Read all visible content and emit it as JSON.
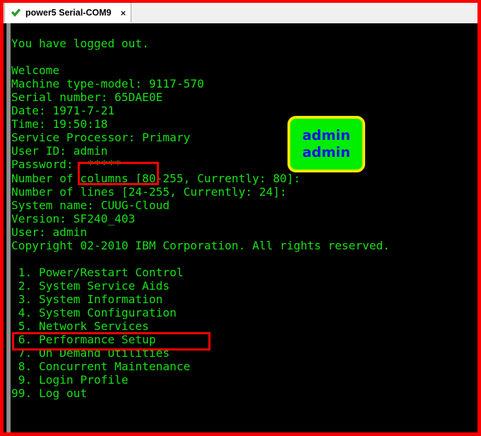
{
  "window": {
    "annotation_border_color": "#fe0000",
    "background_color": "#f0f0f0"
  },
  "tab": {
    "status_icon": "green-check-icon",
    "title": "power5 Serial-COM9",
    "close_label": "×"
  },
  "terminal": {
    "background_color": "#000000",
    "text_color": "#16e016",
    "lines": [
      "",
      "You have logged out.",
      "",
      "Welcome",
      "Machine type-model: 9117-570",
      "Serial number: 65DAE0E",
      "Date: 1971-7-21",
      "Time: 19:50:18",
      "Service Processor: Primary",
      "User ID: admin",
      "Password:  *****",
      "Number of columns [80-255, Currently: 80]:",
      "Number of lines [24-255, Currently: 24]:",
      "System name: CUUG-Cloud",
      "Version: SF240_403",
      "User: admin",
      "Copyright 02-2010 IBM Corporation. All rights reserved.",
      "",
      " 1. Power/Restart Control",
      " 2. System Service Aids",
      " 3. System Information",
      " 4. System Configuration",
      " 5. Network Services",
      " 6. Performance Setup",
      " 7. On Demand Utilities",
      " 8. Concurrent Maintenance",
      " 9. Login Profile",
      "99. Log out"
    ],
    "fields": {
      "machine_type_model": "9117-570",
      "serial_number": "65DAE0E",
      "date": "1971-7-21",
      "time": "19:50:18",
      "service_processor": "Primary",
      "user_id": "admin",
      "password_masked": "*****",
      "columns_range": "80-255",
      "columns_current": "80",
      "lines_range": "24-255",
      "lines_current": "24",
      "system_name": "CUUG-Cloud",
      "version": "SF240_403",
      "user": "admin",
      "copyright": "Copyright 02-2010 IBM Corporation. All rights reserved."
    },
    "menu": [
      {
        "number": " 1.",
        "label": "Power/Restart Control"
      },
      {
        "number": " 2.",
        "label": "System Service Aids"
      },
      {
        "number": " 3.",
        "label": "System Information"
      },
      {
        "number": " 4.",
        "label": "System Configuration"
      },
      {
        "number": " 5.",
        "label": "Network Services"
      },
      {
        "number": " 6.",
        "label": "Performance Setup"
      },
      {
        "number": " 7.",
        "label": "On Demand Utilities"
      },
      {
        "number": " 8.",
        "label": "Concurrent Maintenance"
      },
      {
        "number": " 9.",
        "label": "Login Profile"
      },
      {
        "number": "99.",
        "label": "Log out"
      }
    ]
  },
  "annotations": {
    "highlight_color": "#fe0000",
    "credentials_box_target": "User ID: admin / Password: *****",
    "network_box_target": " 5. Network Services",
    "callout": {
      "fill_color": "#00ee00",
      "border_color": "#ffe800",
      "text_color": "#1414e6",
      "line1": "admin",
      "line2": "admin"
    }
  }
}
